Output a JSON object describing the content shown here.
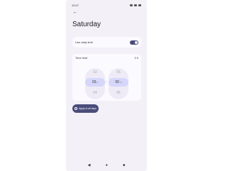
{
  "status_bar": {
    "time": "10:07",
    "icons": [
      "wifi-icon",
      "signal-icon",
      "battery-icon"
    ]
  },
  "page": {
    "title": "Saturday"
  },
  "daily_limit": {
    "label": "Use daily limit",
    "enabled": true
  },
  "time_limit": {
    "label": "Time limit",
    "value": "3 h",
    "hours": {
      "prev": "02",
      "selected": "03",
      "unit": "h",
      "next": "04"
    },
    "minutes": {
      "prev": "55",
      "selected": "00",
      "unit": "m",
      "next": "05"
    },
    "separator": ":"
  },
  "apply_button": {
    "label": "Apply to all days"
  },
  "nav": {
    "back": "◀",
    "home": "●",
    "recents": "■"
  },
  "colors": {
    "accent": "#4a4d7a",
    "selected": "#d6d6fb",
    "background": "#f3f0f8"
  }
}
